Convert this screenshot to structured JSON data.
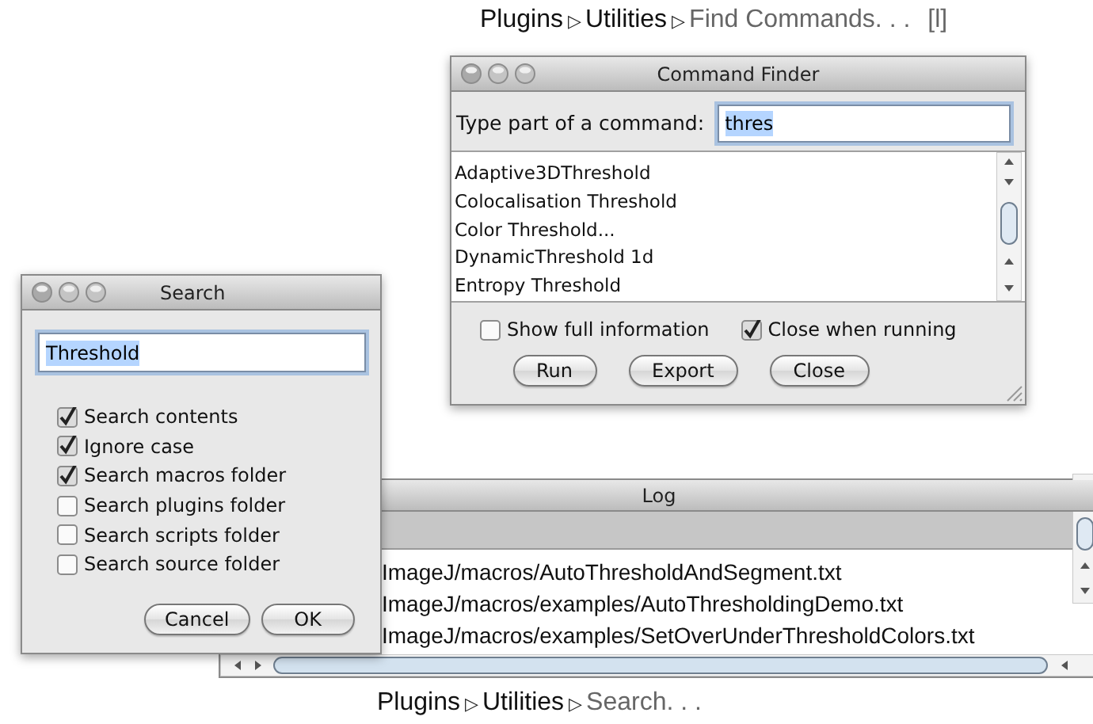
{
  "top_caption": {
    "parts": [
      {
        "kind": "menu",
        "text": "Plugins"
      },
      {
        "kind": "separator",
        "text": "▷"
      },
      {
        "kind": "menu",
        "text": "Utilities"
      },
      {
        "kind": "separator",
        "text": "▷"
      },
      {
        "kind": "command",
        "text": "Find Commands. . ."
      },
      {
        "kind": "shortcut",
        "text": "[l]"
      }
    ]
  },
  "command_finder": {
    "title": "Command Finder",
    "prompt": "Type part of a command:",
    "query": "thres",
    "query_selected": true,
    "results": [
      "Adaptive3DThreshold",
      "Colocalisation Threshold",
      "Color Threshold...",
      "DynamicThreshold 1d",
      "Entropy Threshold"
    ],
    "options": [
      {
        "label": "Show full information",
        "checked": false
      },
      {
        "label": "Close when running",
        "checked": true
      }
    ],
    "buttons": [
      "Run",
      "Export",
      "Close"
    ]
  },
  "log": {
    "title": "Log",
    "lines": [
      "ImageJ/macros/AutoThresholdAndSegment.txt",
      "ImageJ/macros/examples/AutoThresholdingDemo.txt",
      "ImageJ/macros/examples/SetOverUnderThresholdColors.txt"
    ]
  },
  "search": {
    "title": "Search",
    "query": "Threshold",
    "query_selected": true,
    "options": [
      {
        "label": "Search contents",
        "checked": true
      },
      {
        "label": "Ignore case",
        "checked": true
      },
      {
        "label": "Search macros folder",
        "checked": true
      },
      {
        "label": "Search plugins folder",
        "checked": false
      },
      {
        "label": "Search scripts folder",
        "checked": false
      },
      {
        "label": "Search source folder",
        "checked": false
      }
    ],
    "buttons": [
      "Cancel",
      "OK"
    ]
  },
  "bottom_caption": {
    "parts": [
      {
        "kind": "menu",
        "text": "Plugins"
      },
      {
        "kind": "separator",
        "text": "▷"
      },
      {
        "kind": "menu",
        "text": "Utilities"
      },
      {
        "kind": "separator",
        "text": "▷"
      },
      {
        "kind": "command",
        "text": "Search. . ."
      }
    ]
  }
}
